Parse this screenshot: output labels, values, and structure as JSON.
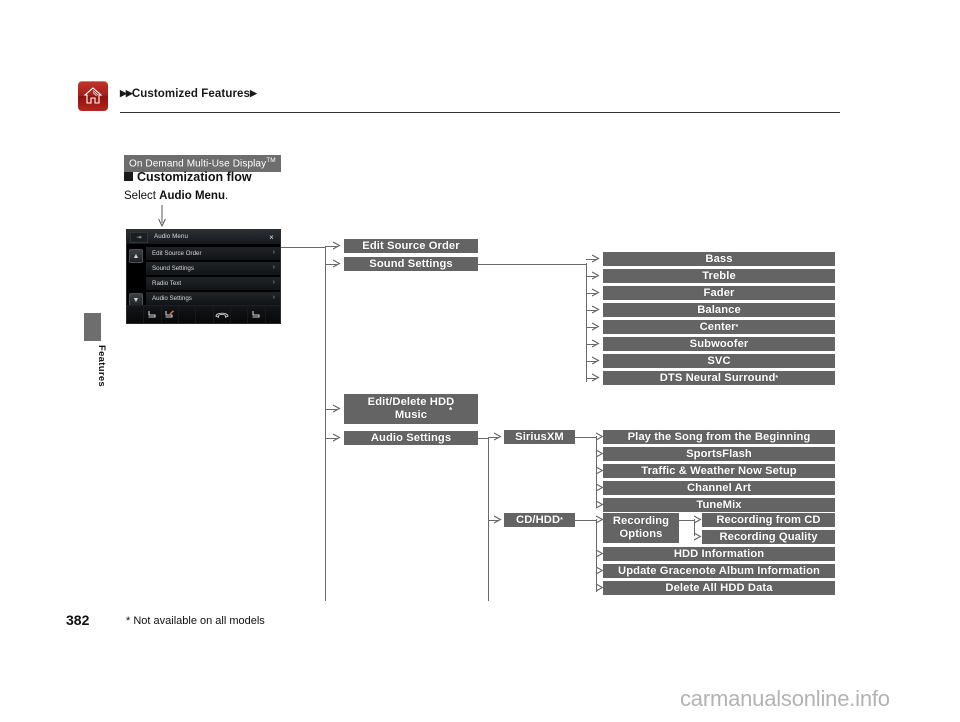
{
  "header": {
    "breadcrumb_prefix": "▶▶",
    "breadcrumb": "Customized Features",
    "breadcrumb_suffix": "▶",
    "home_icon": "home-icon"
  },
  "side_tab": {
    "label": "Features"
  },
  "intro": {
    "chip": "On Demand Multi-Use Display",
    "chip_tm": "TM",
    "heading": "Customization flow",
    "instruction_prefix": "Select ",
    "instruction_bold": "Audio Menu",
    "instruction_suffix": "."
  },
  "device": {
    "title": "Audio Menu",
    "close_label": "×",
    "back_icon": "back-icon",
    "scroll_up_icon": "scroll-up-icon",
    "scroll_down_icon": "scroll-down-icon",
    "rows": [
      {
        "label": "Edit Source Order",
        "chevron": "›"
      },
      {
        "label": "Sound Settings",
        "chevron": "›"
      },
      {
        "label": "Radio Text",
        "chevron": "›"
      },
      {
        "label": "Audio Settings",
        "chevron": "›"
      }
    ],
    "bottom_icons": [
      "blank",
      "seat-icon",
      "seat-heat-icon",
      "blank",
      "blank",
      "phone-icon",
      "blank",
      "seat-icon",
      "blank"
    ]
  },
  "flow": {
    "level1": [
      {
        "id": "edit-source-order",
        "label": "Edit Source Order"
      },
      {
        "id": "sound-settings",
        "label": "Sound Settings"
      },
      {
        "id": "edit-delete-hdd-music",
        "label": "Edit/Delete HDD\nMusic",
        "asterisk": true
      },
      {
        "id": "audio-settings",
        "label": "Audio Settings"
      }
    ],
    "sound_settings_children": [
      {
        "id": "bass",
        "label": "Bass"
      },
      {
        "id": "treble",
        "label": "Treble"
      },
      {
        "id": "fader",
        "label": "Fader"
      },
      {
        "id": "balance",
        "label": "Balance"
      },
      {
        "id": "center",
        "label": "Center",
        "asterisk": true
      },
      {
        "id": "subwoofer",
        "label": "Subwoofer"
      },
      {
        "id": "svc",
        "label": "SVC"
      },
      {
        "id": "dts-neural-surround",
        "label": "DTS Neural Surround",
        "asterisk": true
      }
    ],
    "audio_settings_children": [
      {
        "id": "siriusxm",
        "label": "SiriusXM"
      },
      {
        "id": "cd-hdd",
        "label": "CD/HDD",
        "asterisk": true
      }
    ],
    "siriusxm_children": [
      {
        "id": "play-song-beginning",
        "label": "Play the Song from the Beginning"
      },
      {
        "id": "sportsflash",
        "label": "SportsFlash"
      },
      {
        "id": "traffic-weather-now-setup",
        "label": "Traffic & Weather Now Setup"
      },
      {
        "id": "channel-art",
        "label": "Channel Art"
      },
      {
        "id": "tunemix",
        "label": "TuneMix"
      }
    ],
    "cdhdd_children": [
      {
        "id": "recording-options",
        "label": "Recording\nOptions"
      },
      {
        "id": "hdd-information",
        "label": "HDD Information"
      },
      {
        "id": "update-gracenote-album-information",
        "label": "Update Gracenote Album Information"
      },
      {
        "id": "delete-all-hdd-data",
        "label": "Delete All HDD Data"
      }
    ],
    "recording_options_children": [
      {
        "id": "recording-from-cd",
        "label": "Recording from CD"
      },
      {
        "id": "recording-quality",
        "label": "Recording Quality"
      }
    ]
  },
  "footer": {
    "page_number": "382",
    "footnote": "* Not available on all models",
    "watermark": "carmanualsonline.info"
  },
  "colors": {
    "box_fill": "#646464",
    "line": "#6a6a6a",
    "chip_fill": "#6d6d6d",
    "home_red": "#a32019"
  }
}
